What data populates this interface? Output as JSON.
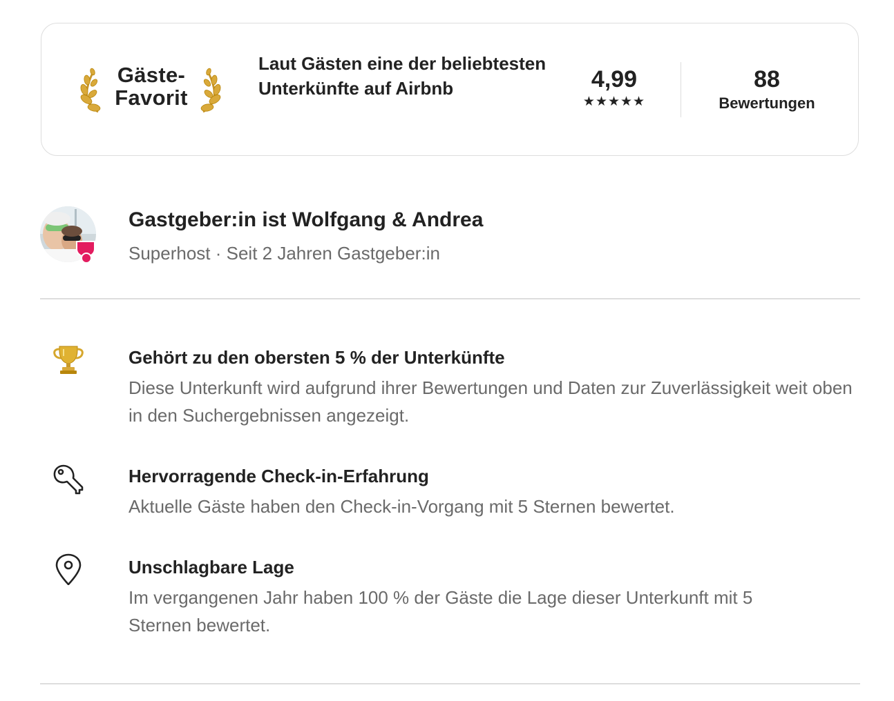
{
  "guest_favorite": {
    "badge_line1": "Gäste-",
    "badge_line2": "Favorit",
    "description": "Laut Gästen eine der beliebtesten Unterkünfte auf Airbnb",
    "rating": "4,99",
    "stars": "★★★★★",
    "reviews_count": "88",
    "reviews_label": "Bewertungen"
  },
  "host": {
    "name_line": "Gastgeber:in ist Wolfgang & Andrea",
    "subtitle": "Superhost · Seit 2 Jahren Gastgeber:in"
  },
  "highlights": [
    {
      "icon": "trophy-icon",
      "title": "Gehört zu den obersten 5 % der Unterkünfte",
      "description": "Diese Unterkunft wird aufgrund ihrer Bewertungen und Daten zur Zuverlässigkeit weit oben in den Suchergebnissen angezeigt."
    },
    {
      "icon": "key-icon",
      "title": "Hervorragende Check-in-Erfahrung",
      "description": "Aktuelle Gäste haben den Check-in-Vorgang mit 5 Sternen bewertet."
    },
    {
      "icon": "location-pin-icon",
      "title": "Unschlagbare Lage",
      "description": "Im vergangenen Jahr haben 100 % der Gäste die Lage dieser Unterkunft mit 5 Sternen bewertet."
    }
  ],
  "colors": {
    "text_primary": "#222222",
    "text_secondary": "#6a6a6a",
    "divider": "#dddddd",
    "superhost_accent": "#e31c5f",
    "laurel_gold": "#d9a93a"
  }
}
